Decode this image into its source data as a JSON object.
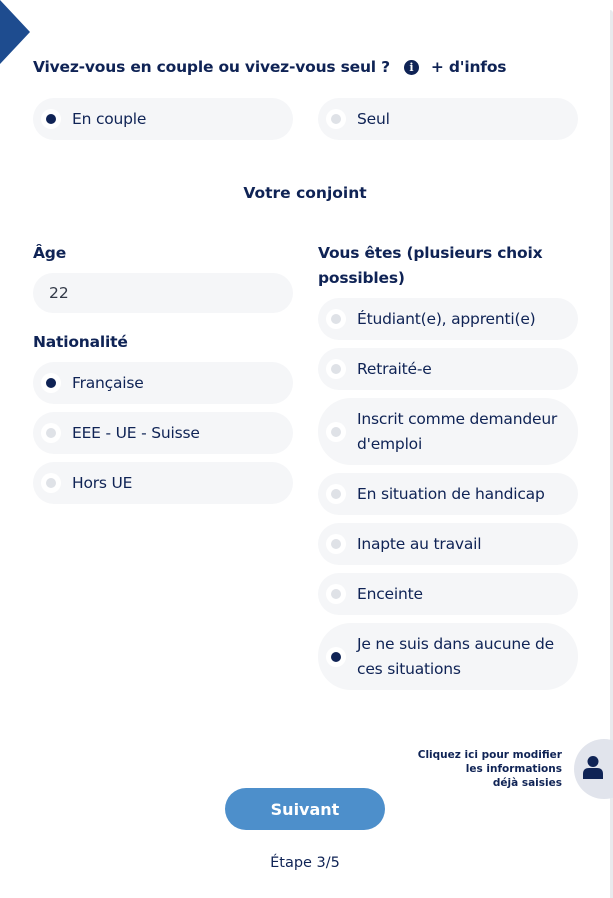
{
  "question": {
    "title": "Vivez-vous en couple ou vivez-vous seul ?",
    "info_icon": "info-circle-icon",
    "more_info_label": "+ d'infos",
    "options": [
      {
        "label": "En couple",
        "checked": true
      },
      {
        "label": "Seul",
        "checked": false
      }
    ]
  },
  "partner": {
    "section_title": "Votre conjoint",
    "age": {
      "label": "Âge",
      "value": "22"
    },
    "nationality": {
      "label": "Nationalité",
      "options": [
        {
          "label": "Française",
          "checked": true
        },
        {
          "label": "EEE - UE - Suisse",
          "checked": false
        },
        {
          "label": "Hors UE",
          "checked": false
        }
      ]
    },
    "status": {
      "label": "Vous êtes (plusieurs choix possibles)",
      "options": [
        {
          "label": "Étudiant(e), apprenti(e)",
          "checked": false
        },
        {
          "label": "Retraité-e",
          "checked": false
        },
        {
          "label": "Inscrit comme demandeur d'emploi",
          "checked": false
        },
        {
          "label": "En situation de handicap",
          "checked": false
        },
        {
          "label": "Inapte au travail",
          "checked": false
        },
        {
          "label": "Enceinte",
          "checked": false
        },
        {
          "label": "Je ne suis dans aucune de ces situations",
          "checked": true
        }
      ]
    }
  },
  "help": {
    "text_line1": "Cliquez ici pour modifier",
    "text_line2": "les informations",
    "text_line3": "déjà saisies",
    "icon": "user-icon"
  },
  "footer": {
    "next_label": "Suivant",
    "step_label": "Étape 3/5"
  },
  "colors": {
    "primary_navy": "#0f2355",
    "accent_blue": "#1e4c8f",
    "button_blue": "#4d8fcb",
    "pill_bg": "#f5f6f8"
  }
}
